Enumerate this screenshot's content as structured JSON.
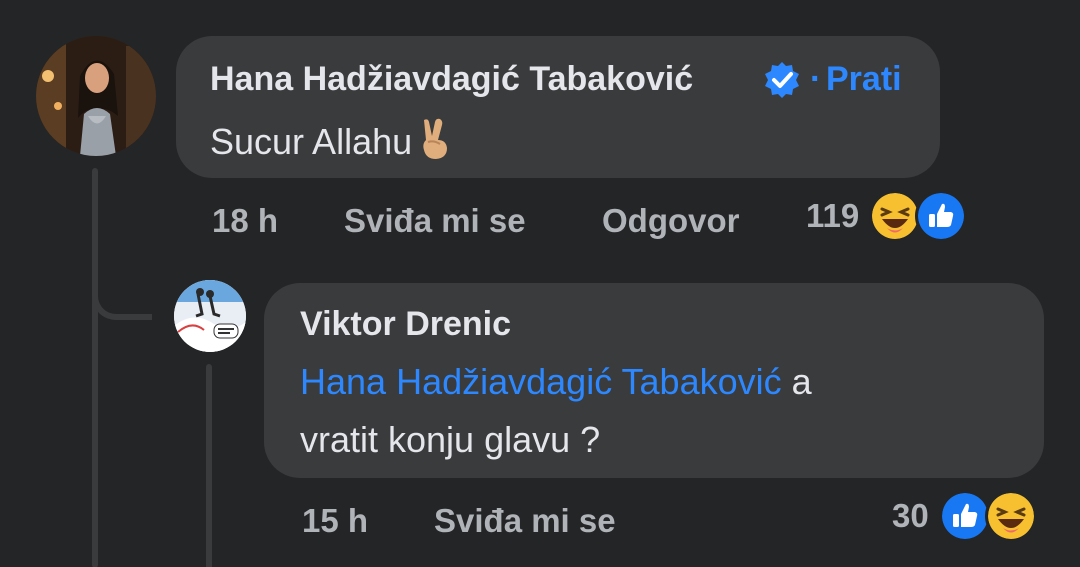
{
  "comments": [
    {
      "author": "Hana Hadžiavdagić Tabaković",
      "verified": true,
      "separator": "·",
      "follow_label": "Prati",
      "text": "Sucur Allahu",
      "emoji": "victory-hand-emoji",
      "time": "18 h",
      "like_label": "Sviđa mi se",
      "reply_label": "Odgovor",
      "reaction_count": "119",
      "reactions": [
        "haha-reaction-icon",
        "like-reaction-icon"
      ]
    },
    {
      "author": "Viktor Drenic",
      "mention": "Hana Hadžiavdagić Tabaković",
      "text_after_mention": "a",
      "text_line2": "vratit konju glavu ?",
      "time": "15 h",
      "like_label": "Sviđa mi se",
      "reaction_count": "30",
      "reactions": [
        "like-reaction-icon",
        "haha-reaction-icon"
      ]
    }
  ],
  "colors": {
    "background": "#242526",
    "bubble": "#3a3b3c",
    "link_blue": "#2d88ff",
    "meta_gray": "#b0b3b8",
    "text": "#e4e6eb"
  }
}
